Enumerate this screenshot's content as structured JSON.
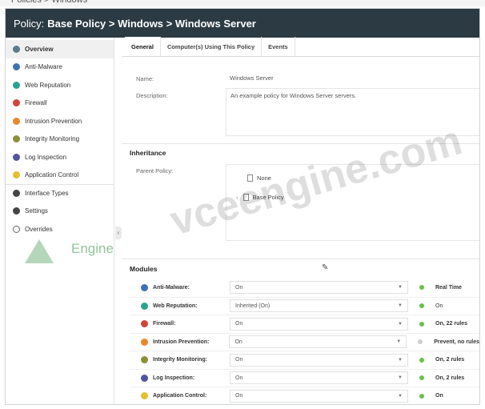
{
  "titlebar": {
    "prefix": "Policy:",
    "path": "Base Policy > Windows > Windows Server"
  },
  "colors": {
    "titlebar_bg": "#2c3a43",
    "status_on": "#6abf4b",
    "status_off": "#cfcfcf"
  },
  "sidebar": {
    "items": [
      {
        "label": "Overview",
        "icon": "overview-icon",
        "color": "#5b7a8a"
      },
      {
        "label": "Anti-Malware",
        "icon": "anti-malware-icon",
        "color": "#3f72b5"
      },
      {
        "label": "Web Reputation",
        "icon": "web-reputation-icon",
        "color": "#2aa38f"
      },
      {
        "label": "Firewall",
        "icon": "firewall-icon",
        "color": "#d0453b"
      },
      {
        "label": "Intrusion Prevention",
        "icon": "intrusion-prevention-icon",
        "color": "#e9892c"
      },
      {
        "label": "Integrity Monitoring",
        "icon": "integrity-monitoring-icon",
        "color": "#8a8f3a"
      },
      {
        "label": "Log Inspection",
        "icon": "log-inspection-icon",
        "color": "#5254a3"
      },
      {
        "label": "Application Control",
        "icon": "application-control-icon",
        "color": "#e3c12d"
      },
      {
        "label": "Interface Types",
        "icon": "interface-types-icon",
        "color": "#444444"
      },
      {
        "label": "Settings",
        "icon": "settings-icon",
        "color": "#444444"
      },
      {
        "label": "Overrides",
        "icon": "overrides-icon",
        "color": "#666666"
      }
    ]
  },
  "tabs": [
    {
      "label": "General"
    },
    {
      "label": "Computer(s) Using This Policy"
    },
    {
      "label": "Events"
    }
  ],
  "general": {
    "name_label": "Name:",
    "name_value": "Windows Server",
    "description_label": "Description:",
    "description_value": "An example policy for Windows Server servers."
  },
  "inheritance": {
    "title": "Inheritance",
    "parent_label": "Parent Policy:",
    "tree": [
      {
        "label": "None"
      },
      {
        "label": "Base Policy"
      }
    ]
  },
  "modules": {
    "title": "Modules",
    "rows": [
      {
        "label": "Anti-Malware:",
        "value": "On",
        "status": "Real Time",
        "icon_color": "#3f72b5",
        "dot": "#6abf4b"
      },
      {
        "label": "Web Reputation:",
        "value": "Inherited (On)",
        "status": "On",
        "icon_color": "#2aa38f",
        "dot": "#6abf4b"
      },
      {
        "label": "Firewall:",
        "value": "On",
        "status": "On, 22 rules",
        "icon_color": "#d0453b",
        "dot": "#6abf4b"
      },
      {
        "label": "Intrusion Prevention:",
        "value": "On",
        "status": "Prevent, no rules",
        "icon_color": "#e9892c",
        "dot": "#cfcfcf"
      },
      {
        "label": "Integrity Monitoring:",
        "value": "On",
        "status": "On, 2 rules",
        "icon_color": "#8a8f3a",
        "dot": "#6abf4b"
      },
      {
        "label": "Log Inspection:",
        "value": "On",
        "status": "On, 2 rules",
        "icon_color": "#5254a3",
        "dot": "#6abf4b"
      },
      {
        "label": "Application Control:",
        "value": "On",
        "status": "On",
        "icon_color": "#e3c12d",
        "dot": "#6abf4b"
      }
    ]
  },
  "watermark": {
    "text": "vceengine.com",
    "logo_text": "Engine"
  }
}
